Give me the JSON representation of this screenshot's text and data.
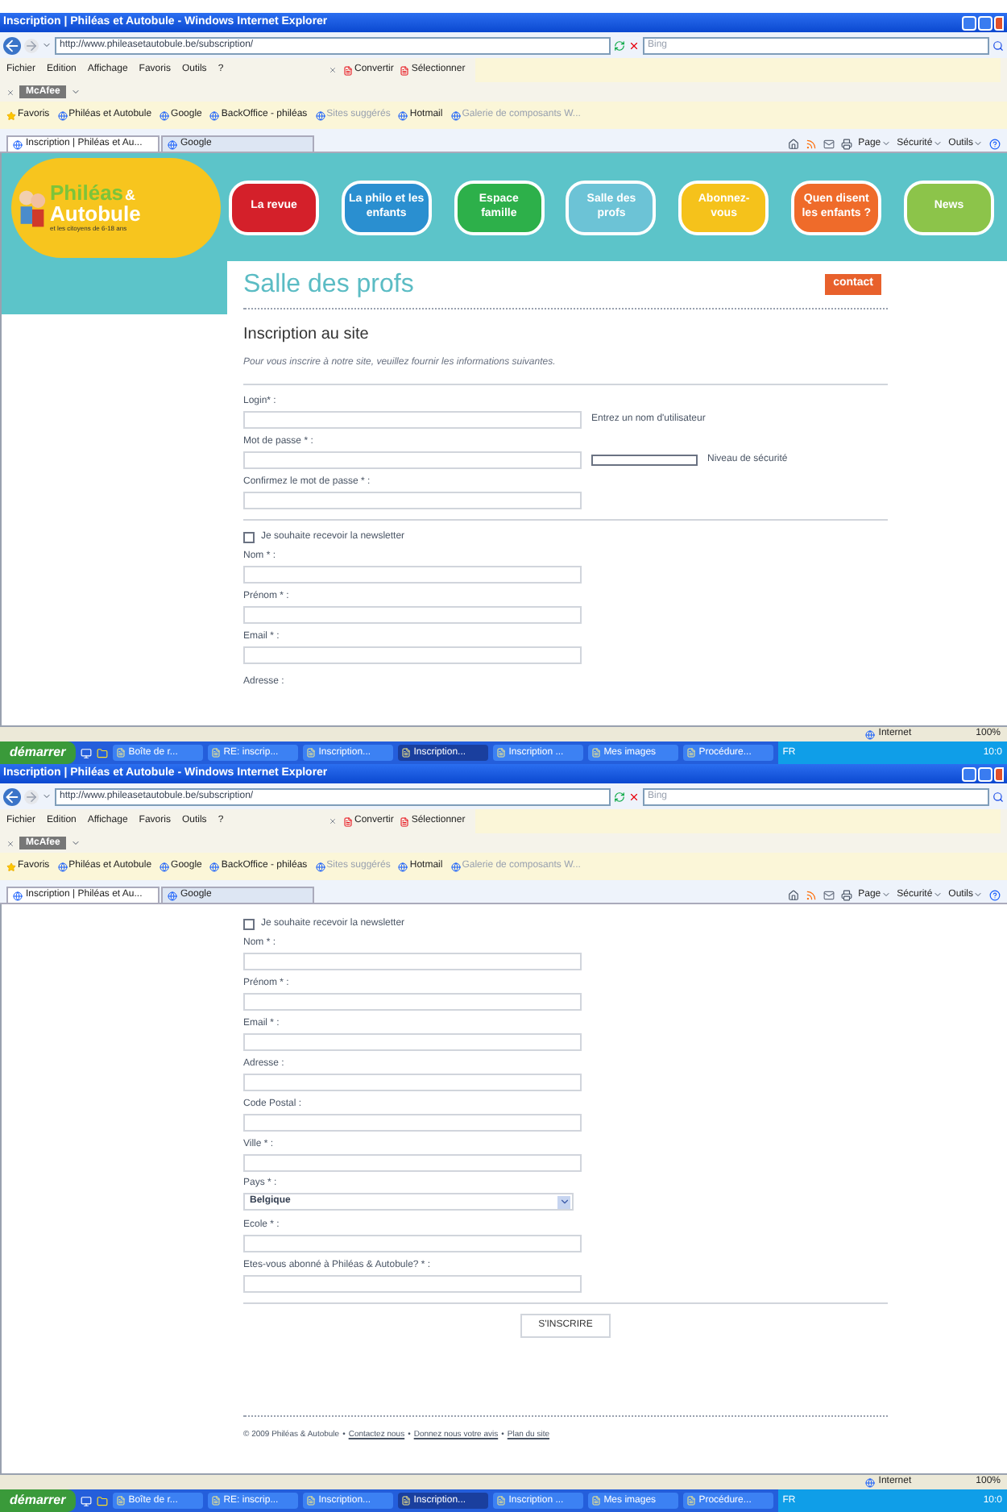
{
  "screens": [
    {
      "window": {
        "title": "Inscription | Philéas et Autobule - Windows Internet Explorer"
      },
      "address": "http://www.phileasetautobule.be/subscription/",
      "search_placeholder": "Bing",
      "menu": [
        "Fichier",
        "Edition",
        "Affichage",
        "Favoris",
        "Outils",
        "?"
      ],
      "toolbar": [
        "Convertir",
        "Sélectionner"
      ],
      "mcafee": "McAfee",
      "favorites": [
        "Favoris",
        "Philéas et Autobule",
        "Google",
        "BackOffice - philéas",
        "Sites suggérés",
        "Hotmail",
        "Galerie de composants W..."
      ],
      "tabs": [
        {
          "label": "Inscription | Philéas et Au...",
          "selected": true
        },
        {
          "label": "Google",
          "selected": false
        }
      ],
      "command_bar": [
        "Page",
        "Sécurité",
        "Outils"
      ],
      "page": {
        "banner": {
          "logo_title": "Philéas",
          "logo_amp": "&",
          "logo_title2": "Autobule",
          "logo_tagline": "et les citoyens de 6-18 ans",
          "nav": [
            {
              "label": "La revue",
              "color": "#d4202a"
            },
            {
              "label": "La philo et les enfants",
              "color": "#2a8fd0"
            },
            {
              "label": "Espace famille",
              "color": "#2db04a"
            },
            {
              "label": "Salle des profs",
              "color": "#6cc3d6"
            },
            {
              "label": "Abonnez-vous",
              "color": "#f5c21b"
            },
            {
              "label": "Quen disent les enfants ?",
              "color": "#ef6b2a"
            },
            {
              "label": "News",
              "color": "#8cc44a"
            }
          ]
        },
        "heading": "Salle des profs",
        "contact": "contact",
        "form_title": "Inscription au site",
        "intro": "Pour vous inscrire à notre site, veuillez fournir les informations suivantes.",
        "fields": [
          {
            "kind": "divider"
          },
          {
            "kind": "text",
            "label": "Login* :",
            "hint": "Entrez un nom d'utilisateur"
          },
          {
            "kind": "password",
            "label": "Mot de passe * :",
            "level": 0,
            "hint": "Niveau de sécurité"
          },
          {
            "kind": "text",
            "label": "Confirmez le mot de passe * :"
          },
          {
            "kind": "divider"
          },
          {
            "kind": "checkbox",
            "label": "Je souhaite recevoir la newsletter",
            "checked": false
          },
          {
            "kind": "text",
            "label": "Nom * :"
          },
          {
            "kind": "text",
            "label": "Prénom * :"
          },
          {
            "kind": "text",
            "label": "Email * :"
          },
          {
            "kind": "label",
            "label": "Adresse :"
          }
        ]
      },
      "status_bar": {
        "zone": "Internet",
        "zoom": "100%"
      },
      "taskbar": {
        "start": "démarrer",
        "buttons": [
          {
            "label": "Boîte de r...",
            "selected": false
          },
          {
            "label": "RE: inscrip...",
            "selected": false
          },
          {
            "label": "Inscription...",
            "selected": false
          },
          {
            "label": "Inscription...",
            "selected": true
          },
          {
            "label": "Inscription ...",
            "selected": false
          },
          {
            "label": "Mes images",
            "selected": false
          },
          {
            "label": "Procédure...",
            "selected": false
          }
        ],
        "lang": "FR",
        "clock": "10:0"
      }
    },
    {
      "window": {
        "title": "Inscription | Philéas et Autobule - Windows Internet Explorer"
      },
      "address": "http://www.phileasetautobule.be/subscription/",
      "search_placeholder": "Bing",
      "menu": [
        "Fichier",
        "Edition",
        "Affichage",
        "Favoris",
        "Outils",
        "?"
      ],
      "toolbar": [
        "Convertir",
        "Sélectionner"
      ],
      "mcafee": "McAfee",
      "favorites": [
        "Favoris",
        "Philéas et Autobule",
        "Google",
        "BackOffice - philéas",
        "Sites suggérés",
        "Hotmail",
        "Galerie de composants W..."
      ],
      "tabs": [
        {
          "label": "Inscription | Philéas et Au...",
          "selected": true
        },
        {
          "label": "Google",
          "selected": false
        }
      ],
      "command_bar": [
        "Page",
        "Sécurité",
        "Outils"
      ],
      "page": {
        "fields": [
          {
            "kind": "checkbox",
            "label": "Je souhaite recevoir la newsletter",
            "checked": false
          },
          {
            "kind": "text",
            "label": "Nom * :"
          },
          {
            "kind": "text",
            "label": "Prénom * :"
          },
          {
            "kind": "text",
            "label": "Email * :"
          },
          {
            "kind": "text",
            "label": "Adresse :"
          },
          {
            "kind": "text",
            "label": "Code Postal :"
          },
          {
            "kind": "text",
            "label": "Ville * :"
          },
          {
            "kind": "select",
            "label": "Pays * :",
            "value": "Belgique"
          },
          {
            "kind": "text",
            "label": "Ecole * :"
          },
          {
            "kind": "text",
            "label": "Etes-vous abonné à Philéas & Autobule? * :"
          },
          {
            "kind": "divider"
          }
        ],
        "submit": "S'INSCRIRE",
        "footer": [
          {
            "kind": "text",
            "text": "© 2009 Philéas & Autobule"
          },
          {
            "kind": "sep",
            "text": "•"
          },
          {
            "kind": "link",
            "text": "Contactez nous"
          },
          {
            "kind": "sep",
            "text": "•"
          },
          {
            "kind": "link",
            "text": "Donnez nous votre avis"
          },
          {
            "kind": "sep",
            "text": "•"
          },
          {
            "kind": "link",
            "text": "Plan du site"
          }
        ]
      },
      "status_bar": {
        "zone": "Internet",
        "zoom": "100%"
      },
      "taskbar": {
        "start": "démarrer",
        "buttons": [
          {
            "label": "Boîte de r...",
            "selected": false
          },
          {
            "label": "RE: inscrip...",
            "selected": false
          },
          {
            "label": "Inscription...",
            "selected": false
          },
          {
            "label": "Inscription...",
            "selected": true
          },
          {
            "label": "Inscription ...",
            "selected": false
          },
          {
            "label": "Mes images",
            "selected": false
          },
          {
            "label": "Procédure...",
            "selected": false
          }
        ],
        "lang": "FR",
        "clock": "10:0"
      }
    }
  ]
}
